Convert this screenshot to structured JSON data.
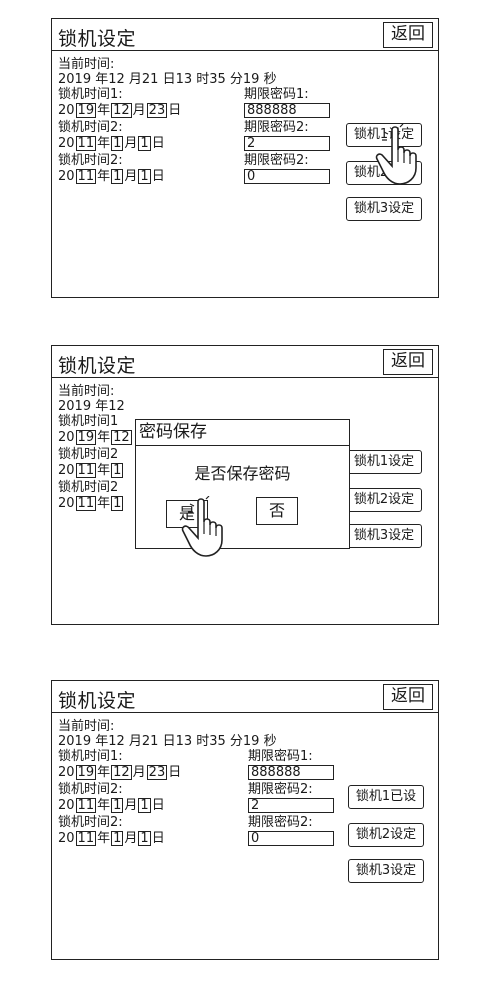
{
  "common": {
    "title": "锁机设定",
    "back_label": "返回",
    "current_time_label": "当前时间:",
    "current_time_value": "2019 年12 月21 日13 时35 分19 秒",
    "current_time_partial": "2019 年12",
    "lock_time_1_label": "锁机时间1:",
    "lock_time_2_label": "锁机时间2:",
    "lock_time_3_label": "锁机时间2:",
    "lock_time_1_partial": "锁机时间1",
    "lock_time_2_partial": "锁机时间2",
    "lock_time_3_partial": "锁机时间2",
    "pwd_1_label": "期限密码1:",
    "pwd_2_label": "期限密码2:",
    "pwd_3_label": "期限密码2:",
    "pwd_1_value": "888888",
    "pwd_2_value": "2",
    "pwd_3_value": "0",
    "date_prefix": "20",
    "year_unit": "年",
    "month_unit": "月",
    "day_unit": "日",
    "date1": {
      "year": "19",
      "month": "12",
      "day": "23"
    },
    "date2": {
      "year": "11",
      "month": "1",
      "day": "1"
    },
    "date3": {
      "year": "11",
      "month": "1",
      "day": "1"
    },
    "lock1_btn": "锁机1设定",
    "lock2_btn": "锁机2设定",
    "lock3_btn": "锁机3设定",
    "lock1_btn_partial_1": "锁机1设定",
    "lock1_btn_done": "锁机1已设"
  },
  "dialog": {
    "title": "密码保存",
    "message": "是否保存密码",
    "yes_label": "是",
    "no_label": "否"
  },
  "icons": {
    "hand": "hand-pointer-icon"
  }
}
